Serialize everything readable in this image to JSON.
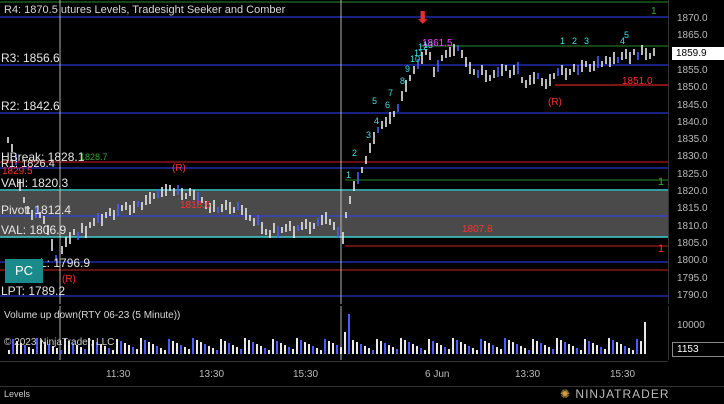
{
  "chart_title": "R4: 1870.5",
  "title_suffix": "utures Levels, Tradesight Seeker and Comber",
  "volume_title": "Volume up down(RTY 06-23 (5 Minute))",
  "copyright": "© 2023 NinjaTrader, LLC",
  "brand": "NINJATRADER",
  "bottom_tab": "Levels",
  "pc_badge": "PC",
  "levels": {
    "r3": "R3: 1856.6",
    "r2": "R2: 1842.6",
    "hbreak": "HBreak: 1828.1",
    "r1": "R1: 1826.4",
    "vah": "VAH: 1820.3",
    "vah_extra": "1819.4",
    "pivot": "Pivot: 1812.4",
    "val": "VAL: 1806.9",
    "l_level": "L: 1796.9",
    "lpt": "LPT: 1789.2"
  },
  "price_ticks": [
    "1870.0",
    "1865.0",
    "1860.0",
    "1855.0",
    "1850.0",
    "1845.0",
    "1840.0",
    "1835.0",
    "1830.0",
    "1825.0",
    "1820.0",
    "1815.0",
    "1810.0",
    "1805.0",
    "1800.0",
    "1795.0",
    "1790.0"
  ],
  "current_price": "1859.9",
  "volume_ticks": [
    "10000",
    "5000"
  ],
  "current_volume": "1153",
  "time_ticks": [
    "11:30",
    "13:30",
    "15:30",
    "6 Jun",
    "13:30",
    "15:30"
  ],
  "annotations": {
    "hi_value": "1861.5",
    "r_right_value": "1851.0",
    "val_value": "1807.8",
    "mid_value": "1818.6",
    "left_value": "1829.5",
    "small_value": "1828.7",
    "r_mark": "(R)",
    "one": "1",
    "seq": [
      "1",
      "2",
      "3",
      "4",
      "5",
      "6",
      "7",
      "8",
      "9",
      "10",
      "11",
      "12",
      "13"
    ]
  },
  "colors": {
    "level_blue": "#3040ff",
    "level_red": "#d02020",
    "level_cyan": "#40d0d0",
    "level_green": "#2a8a2a",
    "va_fill": "#6a6a6a",
    "bar_white": "#e8e8e8",
    "bar_blue": "#4a5cff",
    "seq_cyan": "#40e0e0",
    "seq_green": "#3aa53a",
    "magenta": "#ff3cff",
    "red": "#ff3030"
  }
}
